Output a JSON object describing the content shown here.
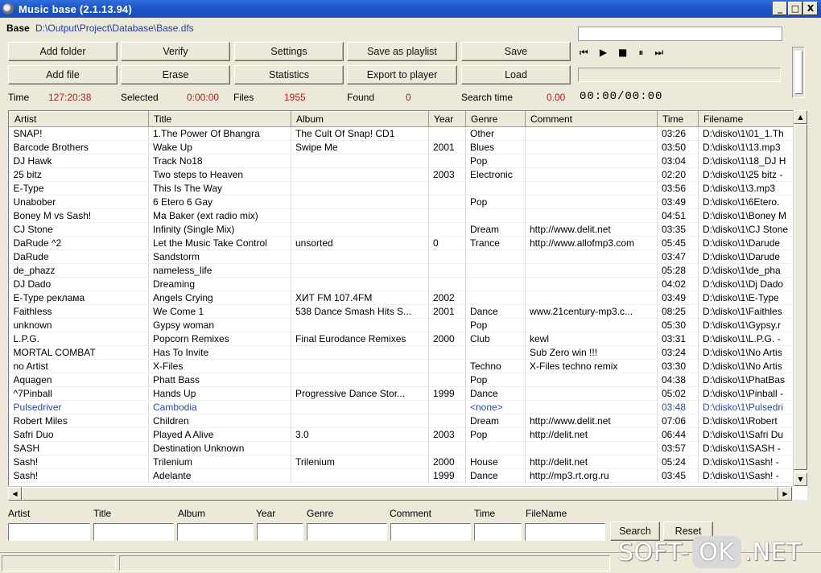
{
  "window": {
    "title": "Music base (2.1.13.94)",
    "minimize": "_",
    "maximize": "□",
    "close": "X"
  },
  "base": {
    "label": "Base",
    "path": "D:\\Output\\Project\\Database\\Base.dfs"
  },
  "buttons": {
    "add_folder": "Add folder",
    "verify": "Verify",
    "settings": "Settings",
    "save_as_playlist": "Save as playlist",
    "save": "Save",
    "add_file": "Add file",
    "erase": "Erase",
    "statistics": "Statistics",
    "export_to_player": "Export to player",
    "load": "Load",
    "search": "Search",
    "reset": "Reset"
  },
  "player": {
    "prev": "⏮",
    "play": "▶",
    "stop": "■",
    "pause": "⏸",
    "next": "⏭",
    "timer": "00:00/00:00",
    "volume": 0.9
  },
  "stats": {
    "time_label": "Time",
    "time_value": "127:20:38",
    "selected_label": "Selected",
    "selected_value": "0:00:00",
    "files_label": "Files",
    "files_value": "1955",
    "found_label": "Found",
    "found_value": "0",
    "search_time_label": "Search time",
    "search_time_value": "0.00"
  },
  "table": {
    "columns": [
      "Artist",
      "Title",
      "Album",
      "Year",
      "Genre",
      "Comment",
      "Time",
      "Filename"
    ],
    "rows": [
      [
        "SNAP!",
        "1.The Power Of Bhangra",
        "The Cult Of Snap! CD1",
        "",
        "Other",
        "",
        "03:26",
        "D:\\disko\\1\\01_1.Th"
      ],
      [
        "Barcode Brothers",
        "Wake Up",
        "Swipe Me",
        "2001",
        "Blues",
        "",
        "03:50",
        "D:\\disko\\1\\13.mp3"
      ],
      [
        "DJ Hawk",
        "Track No18",
        "",
        "",
        "Pop",
        "",
        "03:04",
        "D:\\disko\\1\\18_DJ H"
      ],
      [
        "25 bitz",
        "Two steps to Heaven",
        "",
        "2003",
        "Electronic",
        "",
        "02:20",
        "D:\\disko\\1\\25 bitz -"
      ],
      [
        "E-Type",
        "This Is The Way",
        "",
        "",
        "",
        "",
        "03:56",
        "D:\\disko\\1\\3.mp3"
      ],
      [
        "Unabober",
        "6 Etero 6 Gay",
        "",
        "",
        "Pop",
        "",
        "03:49",
        "D:\\disko\\1\\6Etero."
      ],
      [
        "Boney M vs Sash!",
        "Ma Baker (ext radio mix)",
        "",
        "",
        "",
        "",
        "04:51",
        "D:\\disko\\1\\Boney M"
      ],
      [
        "CJ Stone",
        "Infinity (Single Mix)",
        "",
        "",
        "Dream",
        "http://www.delit.net",
        "03:35",
        "D:\\disko\\1\\CJ Stone"
      ],
      [
        "DaRude ^2",
        "Let the Music Take Control",
        "unsorted",
        "0",
        "Trance",
        "http://www.allofmp3.com",
        "05:45",
        "D:\\disko\\1\\Darude"
      ],
      [
        "DaRude",
        "Sandstorm",
        "",
        "",
        "",
        "",
        "03:47",
        "D:\\disko\\1\\Darude"
      ],
      [
        "de_phazz",
        "nameless_life",
        "",
        "",
        "",
        "",
        "05:28",
        "D:\\disko\\1\\de_pha"
      ],
      [
        "DJ Dado",
        "Dreaming",
        "",
        "",
        "",
        "",
        "04:02",
        "D:\\disko\\1\\Dj Dado"
      ],
      [
        "E-Type реклама",
        "Angels Crying",
        "ХИТ FM 107.4FM",
        "2002",
        "",
        "",
        "03:49",
        "D:\\disko\\1\\E-Type"
      ],
      [
        "Faithless",
        "We Come 1",
        "538 Dance Smash Hits S...",
        "2001",
        "Dance",
        "www.21century-mp3.c...",
        "08:25",
        "D:\\disko\\1\\Faithles"
      ],
      [
        "unknown",
        "Gypsy woman",
        "",
        "",
        "Pop",
        "",
        "05:30",
        "D:\\disko\\1\\Gypsy.r"
      ],
      [
        "L.P.G.",
        "Popcorn Remixes",
        "Final Eurodance Remixes",
        "2000",
        "Club",
        "kewl",
        "03:31",
        "D:\\disko\\1\\L.P.G. -"
      ],
      [
        "MORTAL COMBAT",
        "Has To Invite",
        "",
        "",
        "",
        "Sub Zero win !!!",
        "03:24",
        "D:\\disko\\1\\No Artis"
      ],
      [
        "no Artist",
        "X-Files",
        "",
        "",
        "Techno",
        "X-Files techno remix",
        "03:30",
        "D:\\disko\\1\\No Artis"
      ],
      [
        "Aquagen",
        "Phatt Bass",
        "",
        "",
        "Pop",
        "",
        "04:38",
        "D:\\disko\\1\\PhatBas"
      ],
      [
        "^7Pinball",
        "Hands Up",
        "Progressive Dance Stor...",
        "1999",
        "Dance",
        "",
        "05:02",
        "D:\\disko\\1\\Pinball -"
      ],
      [
        "Pulsedriver",
        "Cambodia",
        "",
        "",
        "<none>",
        "",
        "03:48",
        "D:\\disko\\1\\Pulsedri"
      ],
      [
        "Robert Miles",
        "Children",
        "",
        "",
        "Dream",
        "http://www.delit.net",
        "07:06",
        "D:\\disko\\1\\Robert"
      ],
      [
        "Safri Duo",
        "Played A Alive",
        "3.0",
        "2003",
        "Pop",
        "http://delit.net",
        "06:44",
        "D:\\disko\\1\\Safri Du"
      ],
      [
        "SASH",
        "Destination Unknown",
        "",
        "",
        "",
        "",
        "03:57",
        "D:\\disko\\1\\SASH -"
      ],
      [
        "Sash!",
        "Trilenium",
        "Trilenium",
        "2000",
        "House",
        "http://delit.net",
        "05:24",
        "D:\\disko\\1\\Sash! -"
      ],
      [
        "Sash!",
        "Adelante",
        "",
        "1999",
        "Dance",
        "http://mp3.rt.org.ru",
        "03:45",
        "D:\\disko\\1\\Sash! -"
      ]
    ],
    "selected_row": 20
  },
  "filters": {
    "artist": "Artist",
    "title": "Title",
    "album": "Album",
    "year": "Year",
    "genre": "Genre",
    "comment": "Comment",
    "time": "Time",
    "filename": "FileName"
  },
  "watermark": {
    "left": "SOFT-",
    "mid": "OK",
    "right": ".NET"
  },
  "colors": {
    "titlebar": "#1f55c7",
    "stat_value": "#b02020",
    "path": "#1f3fa0",
    "selected_row": "#2a4ca8"
  }
}
